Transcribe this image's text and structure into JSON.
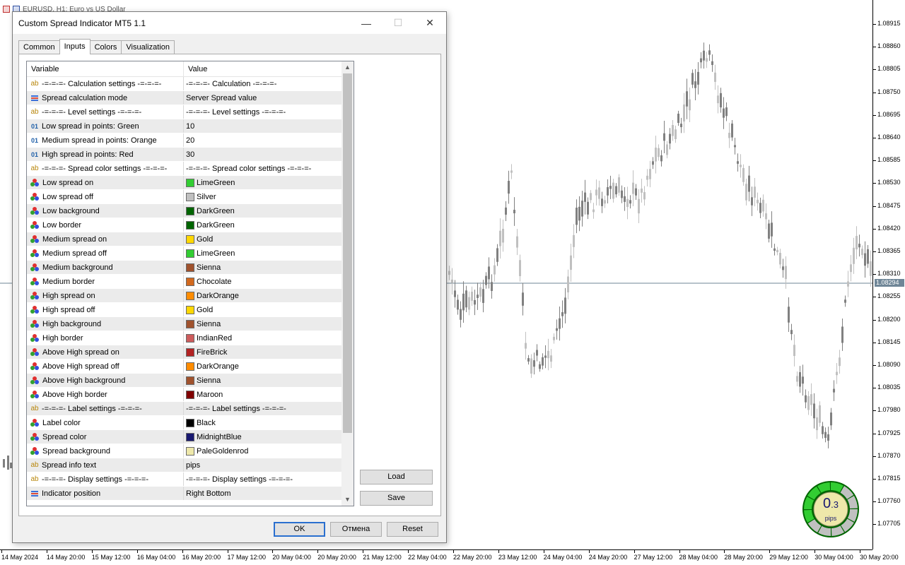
{
  "chart": {
    "header_text": "EURUSD, H1:  Euro vs US Dollar",
    "price_labels": [
      "1.08915",
      "1.08860",
      "1.08805",
      "1.08750",
      "1.08695",
      "1.08640",
      "1.08585",
      "1.08530",
      "1.08475",
      "1.08420",
      "1.08365",
      "1.08310",
      "1.08255",
      "1.08200",
      "1.08145",
      "1.08090",
      "1.08035",
      "1.07980",
      "1.07925",
      "1.07870",
      "1.07815",
      "1.07760",
      "1.07705"
    ],
    "current_price": "1.08294",
    "time_labels": [
      "14 May 2024",
      "14 May 20:00",
      "15 May 12:00",
      "16 May 04:00",
      "16 May 20:00",
      "17 May 12:00",
      "20 May 04:00",
      "20 May 20:00",
      "21 May 12:00",
      "22 May 04:00",
      "22 May 20:00",
      "23 May 12:00",
      "24 May 04:00",
      "24 May 20:00",
      "27 May 12:00",
      "28 May 04:00",
      "28 May 20:00",
      "29 May 12:00",
      "30 May 04:00",
      "30 May 20:00"
    ],
    "colors": {
      "bull": "#c0c0c0",
      "bear": "#808080",
      "price_line": "#6f8697"
    }
  },
  "dialog": {
    "title": "Custom Spread Indicator MT5 1.1",
    "tabs": [
      "Common",
      "Inputs",
      "Colors",
      "Visualization"
    ],
    "active_tab": "Inputs",
    "columns": {
      "variable": "Variable",
      "value": "Value"
    },
    "rows": [
      {
        "type": "ab",
        "variable": "-=-=-=- Calculation settings -=-=-=-",
        "value": "-=-=-=- Calculation -=-=-=-"
      },
      {
        "type": "enum",
        "variable": "Spread calculation mode",
        "value": "Server Spread value"
      },
      {
        "type": "ab",
        "variable": "-=-=-=- Level settings -=-=-=-",
        "value": "-=-=-=- Level settings -=-=-=-"
      },
      {
        "type": "num",
        "variable": "Low spread in points: Green",
        "value": "10"
      },
      {
        "type": "num",
        "variable": "Medium spread in points: Orange",
        "value": "20"
      },
      {
        "type": "num",
        "variable": "High spread in points: Red",
        "value": "30"
      },
      {
        "type": "ab",
        "variable": "-=-=-=- Spread color settings -=-=-=-",
        "value": "-=-=-=- Spread color settings -=-=-=-"
      },
      {
        "type": "color",
        "variable": "Low spread on",
        "value": "LimeGreen",
        "swatch": "#32cd32"
      },
      {
        "type": "color",
        "variable": "Low spread off",
        "value": "Silver",
        "swatch": "#c0c0c0"
      },
      {
        "type": "color",
        "variable": "Low background",
        "value": "DarkGreen",
        "swatch": "#006400"
      },
      {
        "type": "color",
        "variable": "Low border",
        "value": "DarkGreen",
        "swatch": "#006400"
      },
      {
        "type": "color",
        "variable": "Medium spread on",
        "value": "Gold",
        "swatch": "#ffd700"
      },
      {
        "type": "color",
        "variable": "Medium spread off",
        "value": "LimeGreen",
        "swatch": "#32cd32"
      },
      {
        "type": "color",
        "variable": "Medium background",
        "value": "Sienna",
        "swatch": "#a0522d"
      },
      {
        "type": "color",
        "variable": "Medium border",
        "value": "Chocolate",
        "swatch": "#d2691e"
      },
      {
        "type": "color",
        "variable": "High spread on",
        "value": "DarkOrange",
        "swatch": "#ff8c00"
      },
      {
        "type": "color",
        "variable": "High spread off",
        "value": "Gold",
        "swatch": "#ffd700"
      },
      {
        "type": "color",
        "variable": "High background",
        "value": "Sienna",
        "swatch": "#a0522d"
      },
      {
        "type": "color",
        "variable": "High border",
        "value": "IndianRed",
        "swatch": "#cd5c5c"
      },
      {
        "type": "color",
        "variable": "Above High spread on",
        "value": "FireBrick",
        "swatch": "#b22222"
      },
      {
        "type": "color",
        "variable": "Above High spread off",
        "value": "DarkOrange",
        "swatch": "#ff8c00"
      },
      {
        "type": "color",
        "variable": "Above High  background",
        "value": "Sienna",
        "swatch": "#a0522d"
      },
      {
        "type": "color",
        "variable": "Above High border",
        "value": "Maroon",
        "swatch": "#800000"
      },
      {
        "type": "ab",
        "variable": "-=-=-=- Label settings -=-=-=-",
        "value": "-=-=-=- Label settings -=-=-=-"
      },
      {
        "type": "color",
        "variable": "Label color",
        "value": "Black",
        "swatch": "#000000"
      },
      {
        "type": "color",
        "variable": "Spread color",
        "value": "MidnightBlue",
        "swatch": "#191970"
      },
      {
        "type": "color",
        "variable": "Spread background",
        "value": "PaleGoldenrod",
        "swatch": "#eee8aa"
      },
      {
        "type": "ab",
        "variable": "Spread info text",
        "value": "pips"
      },
      {
        "type": "ab",
        "variable": "-=-=-=- Display settings -=-=-=-",
        "value": "-=-=-=- Display settings -=-=-=-"
      },
      {
        "type": "enum",
        "variable": "Indicator position",
        "value": "Right Bottom"
      }
    ],
    "buttons": {
      "load": "Load",
      "save": "Save",
      "ok": "OK",
      "cancel": "Отмена",
      "reset": "Reset"
    },
    "window_controls": {
      "minimize": "—",
      "maximize": "☐",
      "close": "✕"
    }
  },
  "spread_widget": {
    "value_main": "0",
    "value_decimal": ".3",
    "unit": "pips",
    "fill_color": "#32cd32",
    "ring_off": "#c0c0c0",
    "background": "#eee8aa",
    "text_color": "#191970"
  }
}
